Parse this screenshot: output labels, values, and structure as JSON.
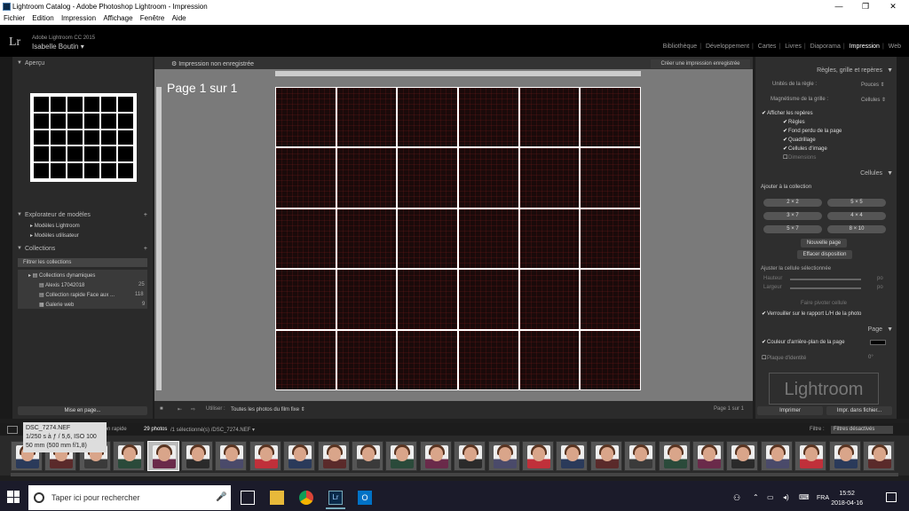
{
  "window": {
    "title": "Lightroom Catalog - Adobe Photoshop Lightroom - Impression",
    "minimize": "—",
    "maximize": "❐",
    "close": "✕"
  },
  "menu": [
    "Fichier",
    "Edition",
    "Impression",
    "Affichage",
    "Fenêtre",
    "Aide"
  ],
  "identity": {
    "logo": "Lr",
    "product": "Adobe Lightroom CC 2015",
    "user": "Isabelle Boutin ▾"
  },
  "modules": [
    "Bibliothèque",
    "Développement",
    "Cartes",
    "Livres",
    "Diaporama",
    "Impression",
    "Web"
  ],
  "active_module": "Impression",
  "left": {
    "preview_title": "Aperçu",
    "templates_title": "Explorateur de modèles",
    "templates": [
      "Modèles Lightroom",
      "Modèles utilisateur"
    ],
    "collections_title": "Collections",
    "filter": "Filtrer les collections",
    "collections": [
      {
        "name": "Collections dynamiques",
        "count": ""
      },
      {
        "name": "Alexis 17042018",
        "count": "25"
      },
      {
        "name": "Collection rapide Face aux ...",
        "count": "118"
      },
      {
        "name": "Galerie web",
        "count": "9"
      }
    ],
    "page_setup": "Mise en page..."
  },
  "center": {
    "title": "Impression non enregistrée",
    "save_btn": "Créer une impression enregistrée",
    "page_label": "Page 1 sur 1",
    "toolbar_use": "Utiliser :",
    "toolbar_source": "Toutes les photos du film fixe",
    "toolbar_page": "Page 1 sur 1"
  },
  "right": {
    "rulers_title": "Règles, grille et repères",
    "ruler_units_label": "Unités de la règle :",
    "ruler_units_value": "Pouces",
    "grid_snap_label": "Magnétisme de la grille :",
    "grid_snap_value": "Cellules",
    "show_guides": "Afficher les repères",
    "guides": [
      "Règles",
      "Fond perdu de la page",
      "Quadrillage",
      "Cellules d'image",
      "Dimensions"
    ],
    "cells_title": "Cellules",
    "add_to_collection": "Ajouter à la collection",
    "cell_buttons": [
      "2 × 2",
      "5 × 5",
      "3 × 7",
      "4 × 4",
      "5 × 7",
      "8 × 10"
    ],
    "new_page": "Nouvelle page",
    "clear_layout": "Effacer disposition",
    "adjust_cell": "Ajuster la cellule sélectionnée",
    "height_label": "Hauteur",
    "width_label": "Largeur",
    "unit": "po",
    "square_cell": "Faire pivoter cellule",
    "lock_ratio": "Verrouiller sur le rapport L/H de la photo",
    "page_title": "Page",
    "bg_color": "Couleur d'arrière-plan de la page",
    "identity_plate": "Plaque d'identité",
    "identity_angle": "0°",
    "watermark": "Lightroom",
    "print_btn": "Imprimer",
    "print_file_btn": "Impr. dans fichier..."
  },
  "filmstrip": {
    "quick_collection": "Collection rapide",
    "photos": "29 photos",
    "selected": "/1 sélectionné(s) /DSC_7274.NEF ▾",
    "filter_label": "Filtre :",
    "filter_value": "Filtres désactivés",
    "tooltip": [
      "DSC_7274.NEF",
      "1/250 s à ƒ / 5,6, ISO 100",
      "50 mm (500 mm f/1,8)"
    ]
  },
  "taskbar": {
    "search": "Taper ici pour rechercher",
    "lang": "FRA",
    "time": "15:52",
    "date": "2018-04-16"
  }
}
